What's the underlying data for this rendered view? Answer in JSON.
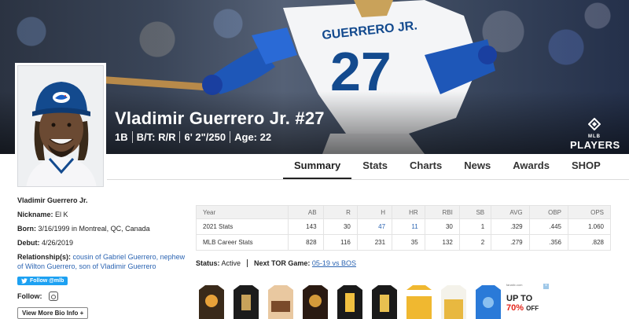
{
  "player": {
    "name": "Vladimir Guerrero Jr. #27",
    "info": [
      "1B",
      "B/T: R/R",
      "6' 2\"/250",
      "Age: 22"
    ],
    "jersey_text": "GUERRERO JR.",
    "jersey_number": "27"
  },
  "brand": {
    "small": "MLB",
    "label": "PLAYERS"
  },
  "colors": {
    "accent": "#2b64b2",
    "blue_jays": "#134a8e",
    "link": "#2b64b2",
    "twitter": "#1da1f2"
  },
  "nav": {
    "tabs": [
      {
        "label": "Summary",
        "active": true
      },
      {
        "label": "Stats",
        "active": false
      },
      {
        "label": "Charts",
        "active": false
      },
      {
        "label": "News",
        "active": false
      },
      {
        "label": "Awards",
        "active": false
      },
      {
        "label": "SHOP",
        "active": false
      }
    ]
  },
  "bio": {
    "name": "Vladimir Guerrero Jr.",
    "nickname_label": "Nickname:",
    "nickname": "El K",
    "born_label": "Born:",
    "born": "3/16/1999 in Montreal, QC, Canada",
    "debut_label": "Debut:",
    "debut": "4/26/2019",
    "relationships_label": "Relationship(s):",
    "relationships": "cousin of Gabriel Guerrero, nephew of Wilton Guerrero, son of Vladimir Guerrero",
    "follow_button": "Follow @mlb",
    "follow_label": "Follow:",
    "more_bio": "View More Bio Info +"
  },
  "stats": {
    "columns": [
      "Year",
      "AB",
      "R",
      "H",
      "HR",
      "RBI",
      "SB",
      "AVG",
      "OBP",
      "OPS"
    ],
    "rows": [
      [
        "2021 Stats",
        "143",
        "30",
        "47",
        "11",
        "30",
        "1",
        ".329",
        ".445",
        "1.060"
      ],
      [
        "MLB Career Stats",
        "828",
        "116",
        "231",
        "35",
        "132",
        "2",
        ".279",
        ".356",
        ".828"
      ]
    ]
  },
  "status": {
    "status_label": "Status:",
    "status_value": "Active",
    "next_label": "Next TOR Game:",
    "next_value": "05-19 vs BOS"
  },
  "ad": {
    "tag": "fanatix.com",
    "line1": "UP TO",
    "percent": "70%",
    "suffix": "OFF"
  }
}
